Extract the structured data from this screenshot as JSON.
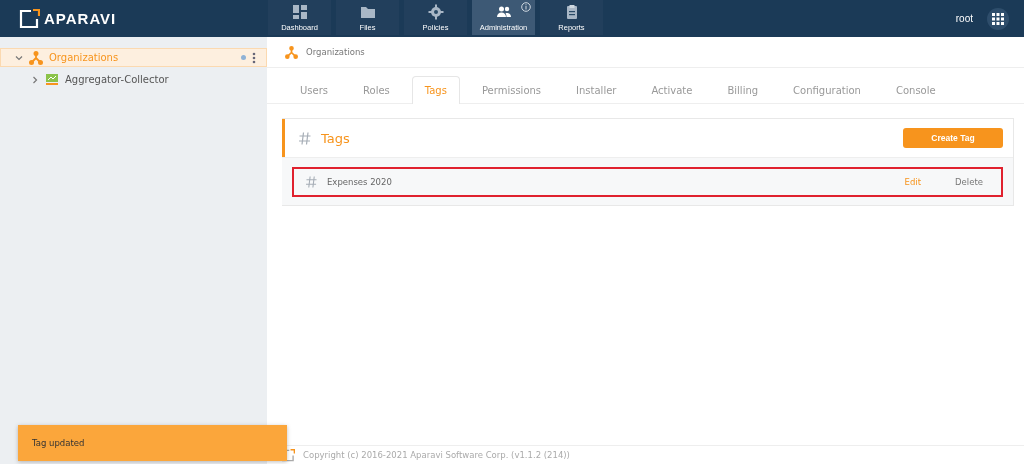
{
  "header": {
    "logo": "APARAVI",
    "nav": [
      {
        "label": "Dashboard",
        "selected": false
      },
      {
        "label": "Files",
        "selected": false
      },
      {
        "label": "Policies",
        "selected": false
      },
      {
        "label": "Administration",
        "selected": true,
        "info": true
      },
      {
        "label": "Reports",
        "selected": false
      }
    ],
    "user": "root"
  },
  "sidebar": {
    "tree": [
      {
        "label": "Organizations",
        "selected": true,
        "expanded": true,
        "children": [
          {
            "label": "Aggregator-Collector",
            "selected": false,
            "expanded": false
          }
        ]
      }
    ]
  },
  "breadcrumb": "Organizations",
  "tabs": [
    {
      "label": "Users",
      "selected": false
    },
    {
      "label": "Roles",
      "selected": false
    },
    {
      "label": "Tags",
      "selected": true
    },
    {
      "label": "Permissions",
      "selected": false
    },
    {
      "label": "Installer",
      "selected": false
    },
    {
      "label": "Activate",
      "selected": false
    },
    {
      "label": "Billing",
      "selected": false
    },
    {
      "label": "Configuration",
      "selected": false
    },
    {
      "label": "Console",
      "selected": false
    }
  ],
  "panel": {
    "title": "Tags",
    "create_button": "Create Tag",
    "rows": [
      {
        "name": "Expenses 2020",
        "edit": "Edit",
        "delete": "Delete",
        "highlighted": true
      }
    ]
  },
  "toast": "Tag updated",
  "footer": "Copyright (c) 2016-2021 Aparavi Software Corp. (v1.1.2 (214))"
}
